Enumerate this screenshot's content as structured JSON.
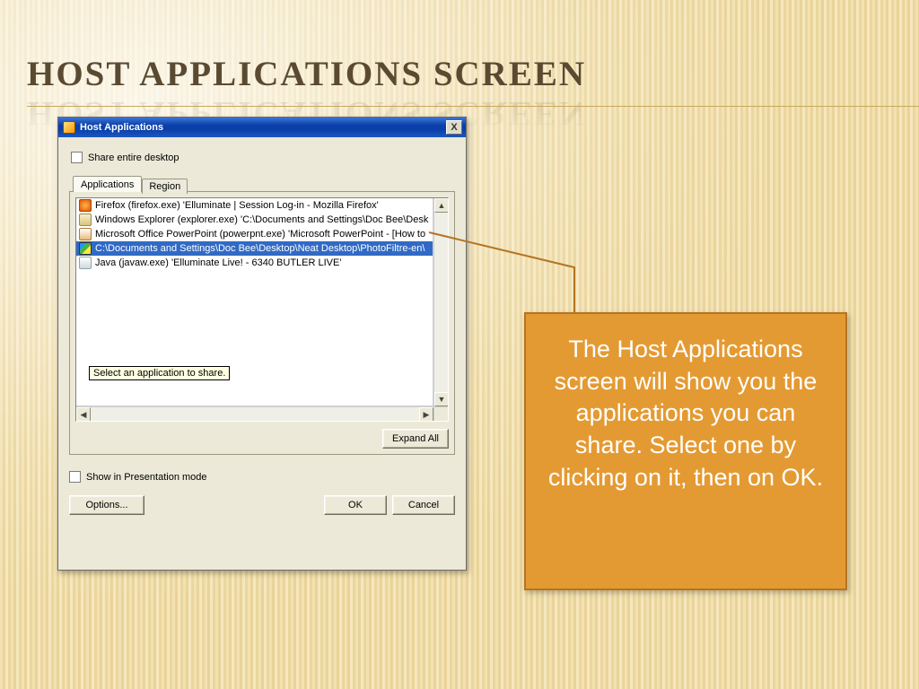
{
  "slide": {
    "title": "HOST APPLICATIONS SCREEN"
  },
  "dialog": {
    "title": "Host Applications",
    "close_glyph": "X",
    "share_desktop_label": "Share entire desktop",
    "tabs": {
      "applications": "Applications",
      "region": "Region"
    },
    "tooltip": "Select an application to share.",
    "expand_all": "Expand All",
    "show_presentation_label": "Show in Presentation mode",
    "options": "Options...",
    "ok": "OK",
    "cancel": "Cancel",
    "apps": [
      {
        "text": "Firefox (firefox.exe) 'Elluminate | Session Log-in - Mozilla Firefox'"
      },
      {
        "text": "Windows Explorer (explorer.exe) 'C:\\Documents and Settings\\Doc Bee\\Desk"
      },
      {
        "text": "Microsoft Office PowerPoint (powerpnt.exe) 'Microsoft PowerPoint - [How to"
      },
      {
        "text": "C:\\Documents and Settings\\Doc Bee\\Desktop\\Neat Desktop\\PhotoFiltre-en\\"
      },
      {
        "text": "Java (javaw.exe) 'Elluminate Live! - 6340 BUTLER LIVE'"
      }
    ],
    "scrollbar": {
      "up": "▲",
      "down": "▼",
      "left": "◀",
      "right": "▶"
    }
  },
  "callout": {
    "text": "The Host Applications screen will show you the applications you can share. Select one by clicking on it, then on OK."
  }
}
